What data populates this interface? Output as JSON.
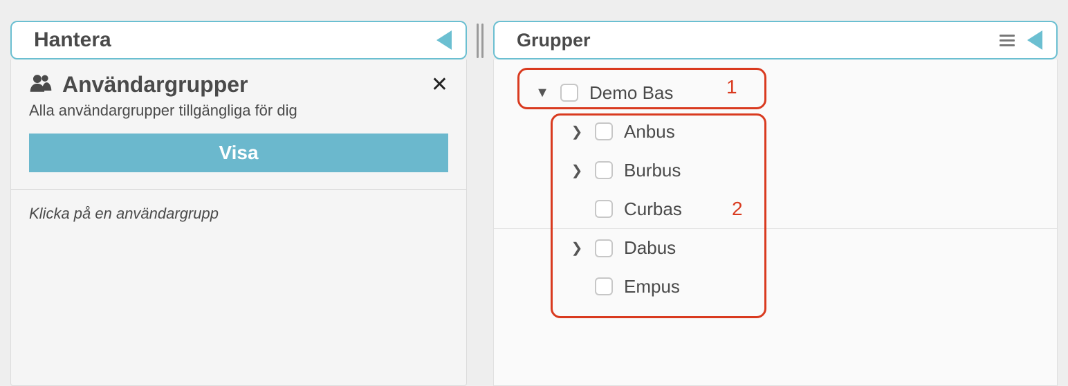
{
  "left": {
    "header_title": "Hantera",
    "section_title": "Användargrupper",
    "section_subtitle": "Alla användargrupper tillgängliga för dig",
    "visa_label": "Visa",
    "hint": "Klicka på en användargrupp"
  },
  "right": {
    "header_title": "Grupper",
    "tree": {
      "root": {
        "label": "Demo Bas",
        "expanded": true
      },
      "children": [
        {
          "label": "Anbus",
          "has_children": true
        },
        {
          "label": "Burbus",
          "has_children": true
        },
        {
          "label": "Curbas",
          "has_children": false
        },
        {
          "label": "Dabus",
          "has_children": true
        },
        {
          "label": "Empus",
          "has_children": false
        }
      ]
    }
  },
  "annotations": {
    "num1": "1",
    "num2": "2"
  }
}
